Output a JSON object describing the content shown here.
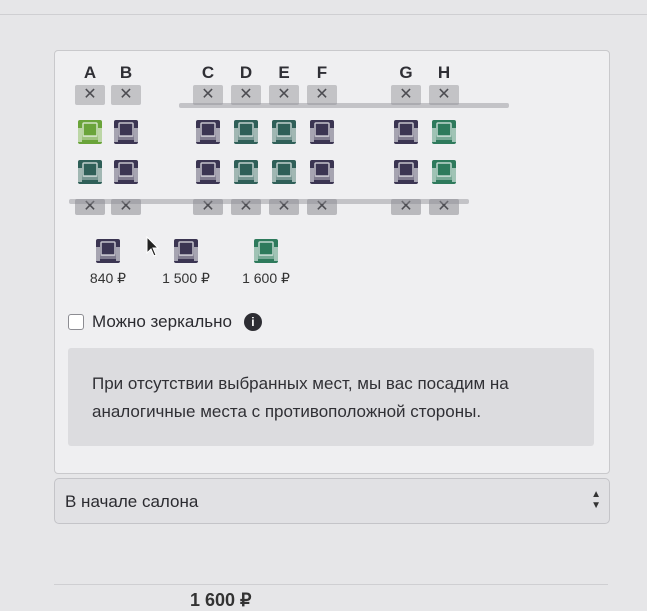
{
  "seat_map": {
    "columns": [
      "A",
      "B",
      "C",
      "D",
      "E",
      "F",
      "G",
      "H"
    ],
    "blocked_symbol": "✕",
    "rows": [
      [
        "green_light",
        "dark",
        "dark",
        "teal",
        "teal",
        "dark",
        "dark",
        "green"
      ],
      [
        "teal",
        "dark",
        "dark",
        "teal",
        "teal",
        "dark",
        "dark",
        "green"
      ]
    ]
  },
  "colors": {
    "dark": "#3b3552",
    "teal": "#2f5f58",
    "green": "#2e7a5c",
    "green_light": "#6aa43a",
    "blocked": "#c3c3c6"
  },
  "legend": [
    {
      "color": "dark",
      "price": "840 ₽"
    },
    {
      "color": "dark",
      "price": "1 500 ₽"
    },
    {
      "color": "green",
      "price": "1 600 ₽"
    }
  ],
  "mirror": {
    "label": "Можно зеркально",
    "info_icon": "info-icon",
    "info_glyph": "i"
  },
  "notice": {
    "text": "При отсутствии выбранных мест, мы вас посадим на аналогичные места с противоположной стороны."
  },
  "location_select": {
    "value": "В начале салона"
  },
  "bottom_price": "1 600 ₽"
}
